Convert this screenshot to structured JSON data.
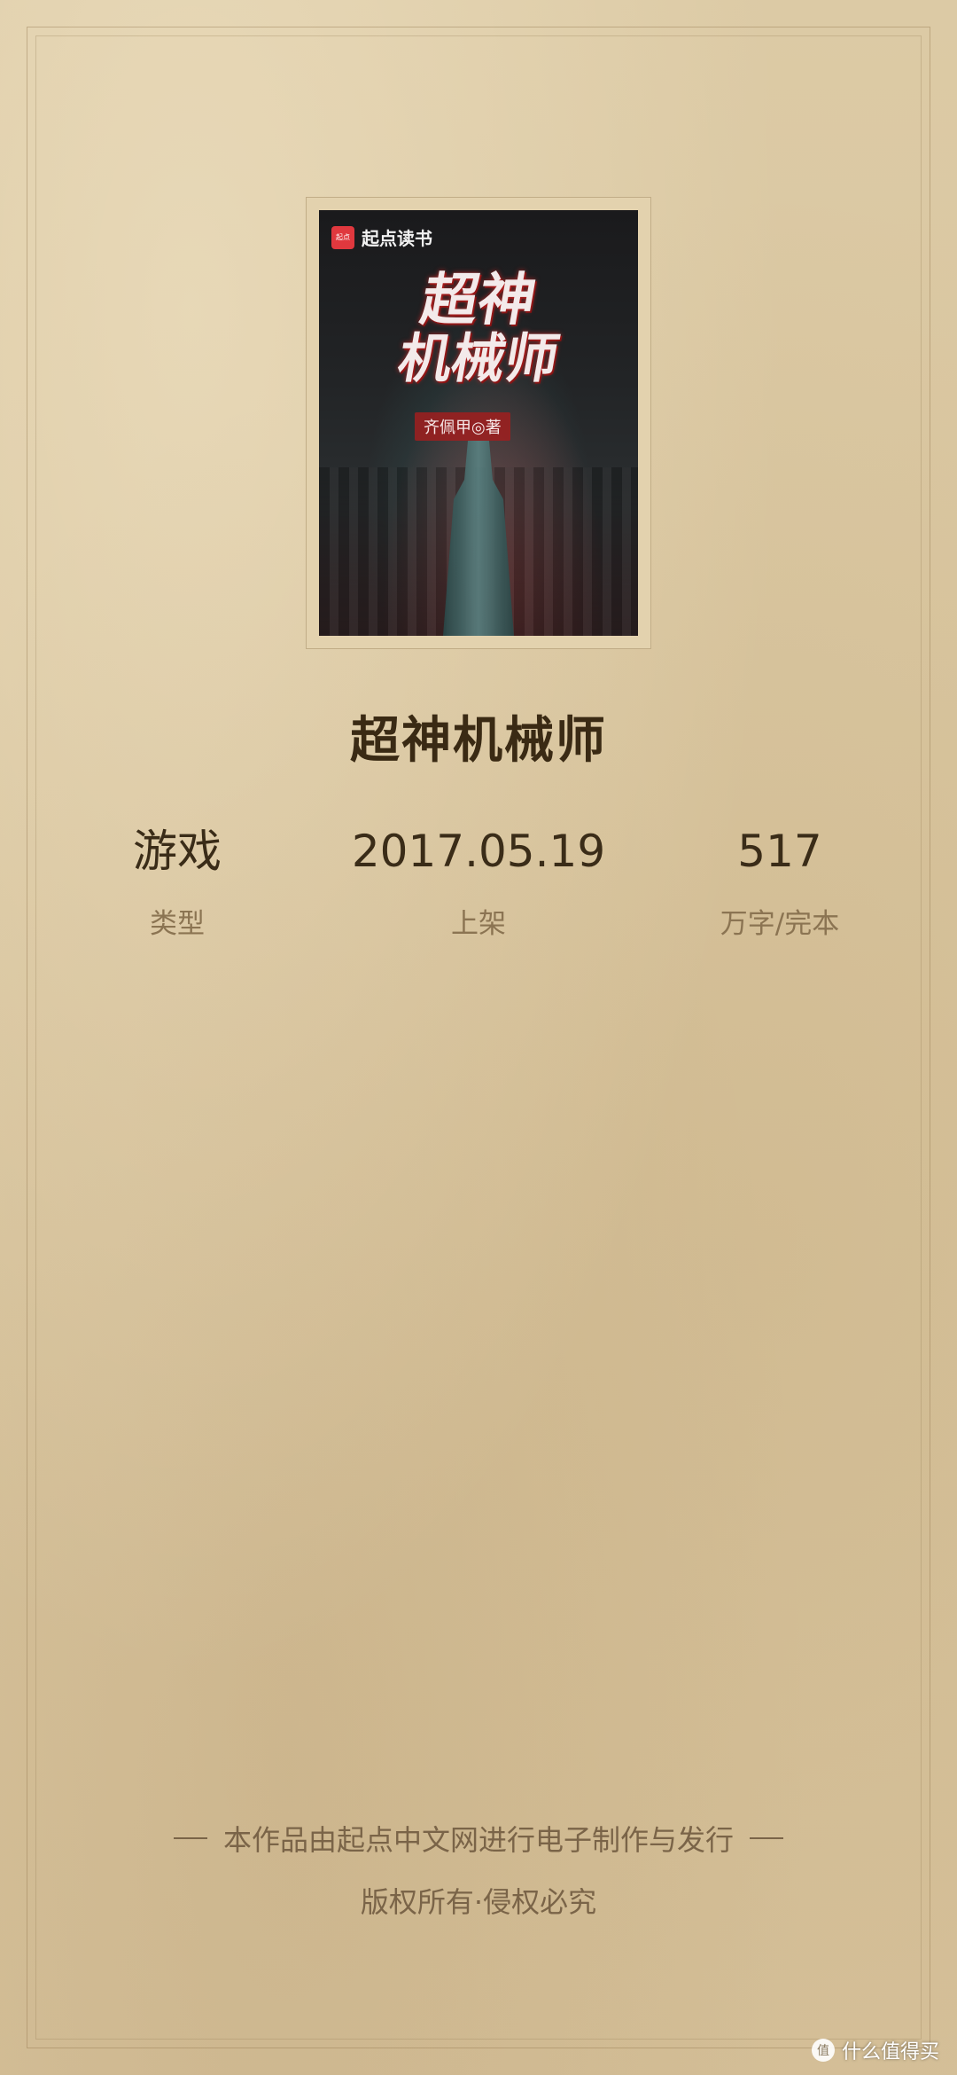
{
  "cover": {
    "brand_badge": "起点",
    "brand_name": "起点读书",
    "title_line1": "超神",
    "title_line2": "机械师",
    "author": "齐佩甲◎著"
  },
  "book": {
    "title": "超神机械师"
  },
  "stats": [
    {
      "value": "游戏",
      "label": "类型"
    },
    {
      "value": "2017.05.19",
      "label": "上架"
    },
    {
      "value": "517",
      "label": "万字/完本"
    }
  ],
  "footer": {
    "line1": "本作品由起点中文网进行电子制作与发行",
    "line2": "版权所有·侵权必究"
  },
  "watermark": {
    "text": "什么值得买",
    "logo_glyph": "值"
  },
  "colors": {
    "background": "#d9c6a0",
    "title_text": "#3a2a14",
    "label_text": "#8b7452"
  }
}
